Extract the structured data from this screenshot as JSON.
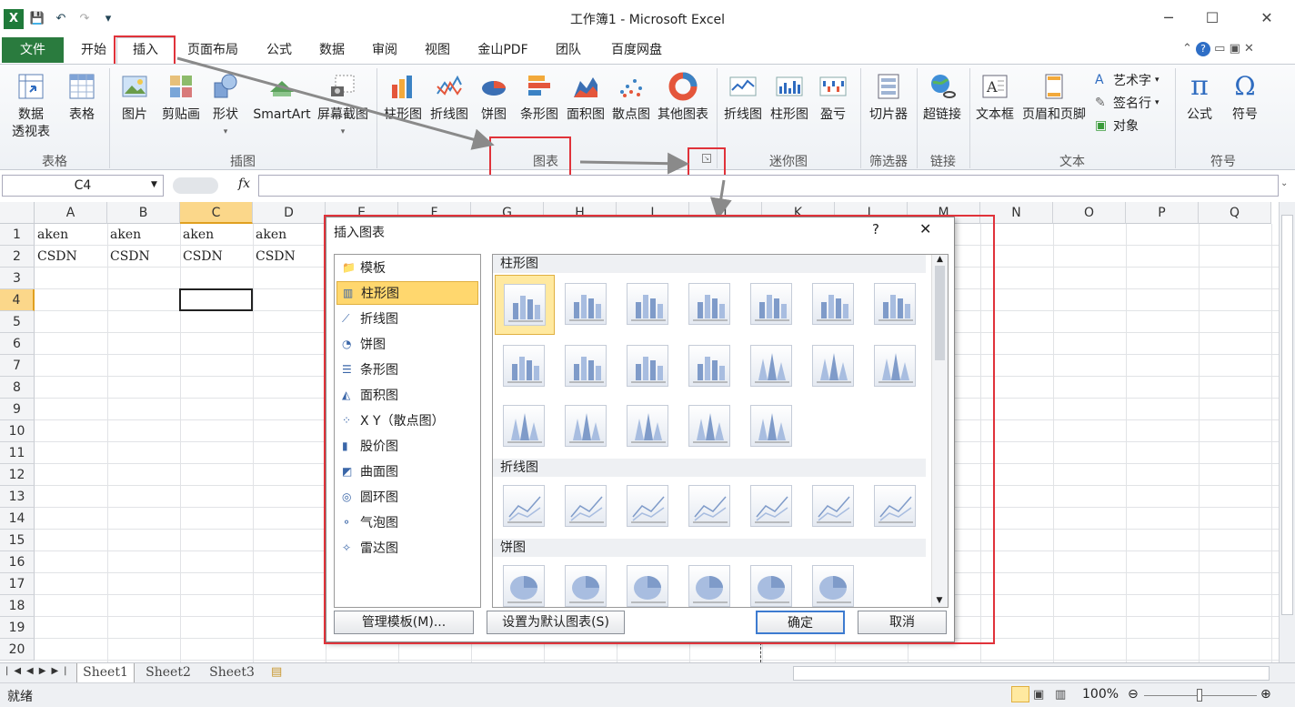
{
  "window": {
    "title": "工作簿1 - Microsoft Excel",
    "min": "─",
    "max": "☐",
    "close": "✕"
  },
  "qat": {
    "app_icon": "X",
    "save": "💾",
    "undo": "↶",
    "redo": "↷",
    "more": "▾"
  },
  "tabs": [
    "文件",
    "开始",
    "插入",
    "页面布局",
    "公式",
    "数据",
    "审阅",
    "视图",
    "金山PDF",
    "团队",
    "百度网盘"
  ],
  "ribbon": {
    "groups": [
      {
        "label": "表格",
        "buttons": [
          "数据\n透视表",
          "表格"
        ]
      },
      {
        "label": "插图",
        "buttons": [
          "图片",
          "剪贴画",
          "形状",
          "SmartArt",
          "屏幕截图"
        ]
      },
      {
        "label": "图表",
        "buttons": [
          "柱形图",
          "折线图",
          "饼图",
          "条形图",
          "面积图",
          "散点图",
          "其他图表"
        ]
      },
      {
        "label": "迷你图",
        "buttons": [
          "折线图",
          "柱形图",
          "盈亏"
        ]
      },
      {
        "label": "筛选器",
        "buttons": [
          "切片器"
        ]
      },
      {
        "label": "链接",
        "buttons": [
          "超链接"
        ]
      },
      {
        "label": "文本",
        "buttons": [
          "文本框",
          "页眉和页脚"
        ],
        "small": [
          "艺术字",
          "签名行",
          "对象"
        ]
      },
      {
        "label": "符号",
        "buttons": [
          "公式",
          "符号"
        ]
      }
    ]
  },
  "formula_bar": {
    "name_box": "C4",
    "fx": "fx"
  },
  "columns": [
    "A",
    "B",
    "C",
    "D",
    "E",
    "F",
    "G",
    "H",
    "I",
    "J",
    "K",
    "L",
    "M",
    "N",
    "O",
    "P",
    "Q"
  ],
  "rows": [
    "1",
    "2",
    "3",
    "4",
    "5",
    "6",
    "7",
    "8",
    "9",
    "10",
    "11",
    "12",
    "13",
    "14",
    "15",
    "16",
    "17",
    "18",
    "19",
    "20"
  ],
  "cells": [
    [
      "aken",
      "aken",
      "aken",
      "aken"
    ],
    [
      "CSDN",
      "CSDN",
      "CSDN",
      "CSDN"
    ]
  ],
  "sheets": [
    "Sheet1",
    "Sheet2",
    "Sheet3"
  ],
  "status": {
    "ready": "就绪",
    "zoom": "100%"
  },
  "dialog": {
    "title": "插入图表",
    "help": "?",
    "close": "✕",
    "categories": [
      "模板",
      "柱形图",
      "折线图",
      "饼图",
      "条形图",
      "面积图",
      "X Y（散点图）",
      "股价图",
      "曲面图",
      "圆环图",
      "气泡图",
      "雷达图"
    ],
    "selected_category": "柱形图",
    "sections": [
      "柱形图",
      "折线图",
      "饼图"
    ],
    "manage_templates": "管理模板(M)...",
    "set_default": "设置为默认图表(S)",
    "ok": "确定",
    "cancel": "取消"
  },
  "colors": {
    "accent_red": "#e0323a",
    "file_tab": "#2a7b3e",
    "selected": "#ffd76e"
  }
}
